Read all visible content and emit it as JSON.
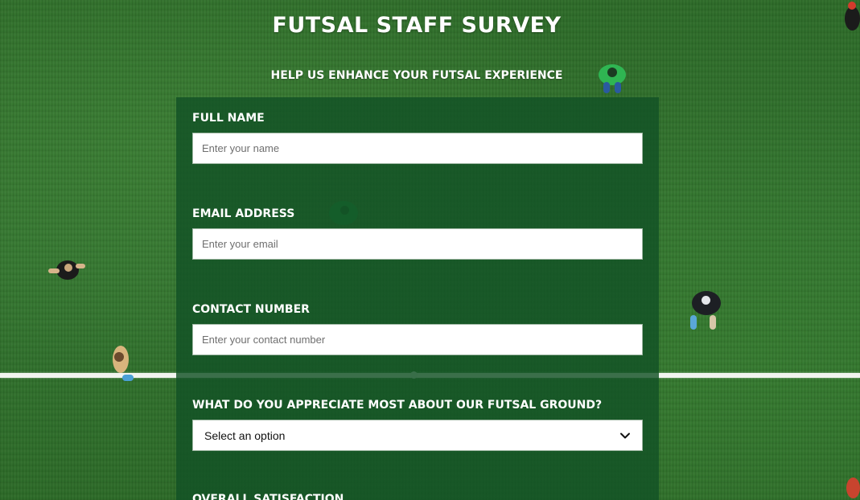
{
  "header": {
    "title": "FUTSAL STAFF SURVEY",
    "subtitle": "HELP US ENHANCE YOUR FUTSAL EXPERIENCE"
  },
  "form": {
    "full_name": {
      "label": "FULL NAME",
      "placeholder": "Enter your name",
      "value": ""
    },
    "email": {
      "label": "EMAIL ADDRESS",
      "placeholder": "Enter your email",
      "value": ""
    },
    "contact": {
      "label": "CONTACT NUMBER",
      "placeholder": "Enter your contact number",
      "value": ""
    },
    "appreciate": {
      "label": "WHAT DO YOU APPRECIATE MOST ABOUT OUR FUTSAL GROUND?",
      "selected": "Select an option"
    },
    "satisfaction": {
      "label": "OVERALL SATISFACTION"
    }
  },
  "icons": {
    "select_arrow": "chevron-down-icon"
  },
  "colors": {
    "panel": "#125226",
    "grass": "#2f6e2a",
    "text": "#ffffff"
  }
}
